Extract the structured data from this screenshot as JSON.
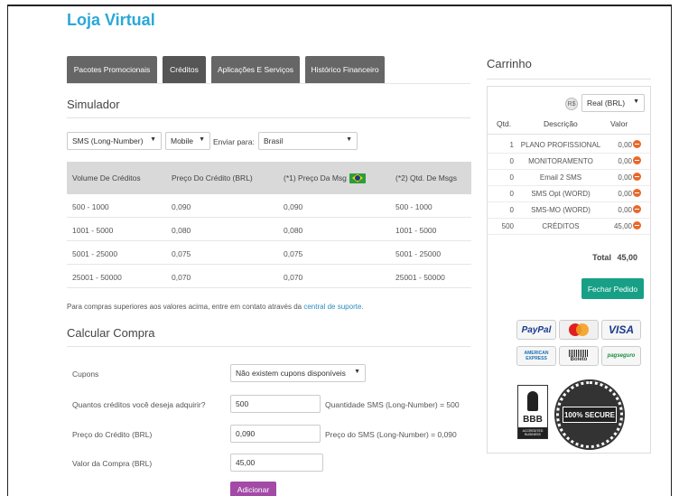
{
  "page": {
    "title": "Loja Virtual"
  },
  "tabs": [
    {
      "label": "Pacotes Promocionais"
    },
    {
      "label": "Créditos"
    },
    {
      "label": "Aplicações E Serviços"
    },
    {
      "label": "Histórico Financeiro"
    }
  ],
  "simulator": {
    "title": "Simulador",
    "product_select": "SMS (Long-Number)",
    "channel_select": "Mobile",
    "send_to_label": "Enviar para:",
    "country_select": "Brasil"
  },
  "table": {
    "headers": [
      "Volume De Créditos",
      "Preço Do Crédito (BRL)",
      "(*1) Preço Da Msg",
      "(*2) Qtd. De Msgs"
    ],
    "rows": [
      [
        "500 - 1000",
        "0,090",
        "0,090",
        "500 - 1000"
      ],
      [
        "1001 - 5000",
        "0,080",
        "0,080",
        "1001 - 5000"
      ],
      [
        "5001 - 25000",
        "0,075",
        "0,075",
        "5001 - 25000"
      ],
      [
        "25001 - 50000",
        "0,070",
        "0,070",
        "25001 - 50000"
      ]
    ]
  },
  "note": {
    "text": "Para compras superiores aos valores acima, entre em contato através da",
    "link": "central de suporte."
  },
  "calc": {
    "title": "Calcular Compra",
    "coupons_label": "Cupons",
    "coupons_select": "Não existem cupons disponíveis",
    "qty_label": "Quantos créditos você deseja adquirir?",
    "qty_value": "500",
    "qty_note": "Quantidade SMS (Long-Number) = 500",
    "price_label": "Preço do Crédito (BRL)",
    "price_value": "0,090",
    "price_note": "Preço do SMS (Long-Number) = 0,090",
    "total_label": "Valor da Compra (BRL)",
    "total_value": "45,00",
    "add_button": "Adicionar"
  },
  "cart": {
    "title": "Carrinho",
    "currency_select": "Real (BRL)",
    "currency_icon": "R$",
    "headers": {
      "qty": "Qtd.",
      "desc": "Descrição",
      "value": "Valor"
    },
    "items": [
      {
        "qty": "1",
        "desc": "PLANO PROFISSIONAL",
        "value": "0,00"
      },
      {
        "qty": "0",
        "desc": "MONITORAMENTO",
        "value": "0,00"
      },
      {
        "qty": "0",
        "desc": "Email 2 SMS",
        "value": "0,00"
      },
      {
        "qty": "0",
        "desc": "SMS Opt (WORD)",
        "value": "0,00"
      },
      {
        "qty": "0",
        "desc": "SMS-MO (WORD)",
        "value": "0,00"
      },
      {
        "qty": "500",
        "desc": "CRÉDITOS",
        "value": "45,00"
      }
    ],
    "total_label": "Total",
    "total_value": "45,00",
    "checkout_button": "Fechar Pedido"
  },
  "badges": {
    "paypal": "PayPal",
    "visa": "VISA",
    "amex": "AMERICAN EXPRESS",
    "boleto": "Boleto",
    "pagseguro": "pagseguro",
    "bbb": "BBB",
    "bbb_sub": "ACCREDITED BUSINESS",
    "secure": "100% SECURE"
  },
  "colors": {
    "accent": "#2aa7d9",
    "tab": "#666666",
    "add": "#a24aa6",
    "checkout": "#17a086",
    "remove": "#e8692b"
  }
}
